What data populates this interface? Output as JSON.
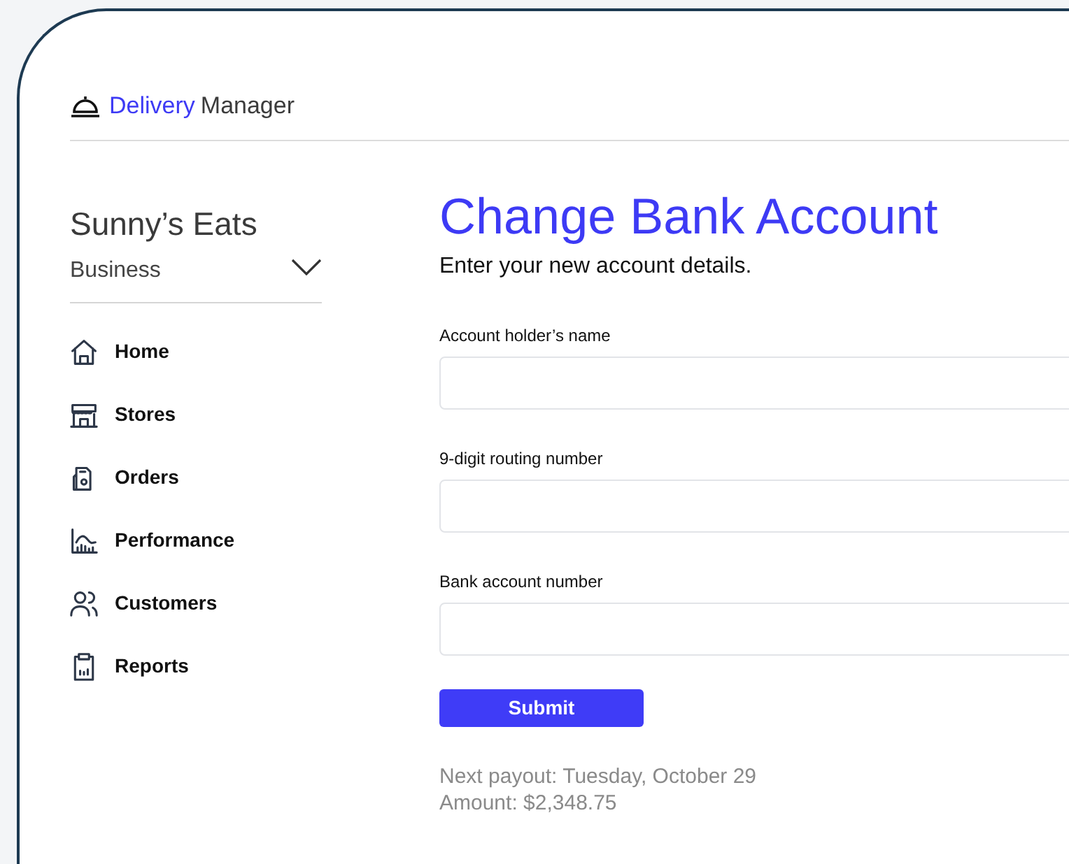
{
  "brand": {
    "part_1": "Delivery",
    "part_2": "Manager"
  },
  "account": {
    "name": "Sunny’s Eats",
    "type": "Business"
  },
  "nav": [
    {
      "label": "Home",
      "kind": "home"
    },
    {
      "label": "Stores",
      "kind": "store"
    },
    {
      "label": "Orders",
      "kind": "orders"
    },
    {
      "label": "Performance",
      "kind": "chart"
    },
    {
      "label": "Customers",
      "kind": "people"
    },
    {
      "label": "Reports",
      "kind": "clipboard"
    }
  ],
  "page": {
    "title": "Change Bank Account",
    "subtitle": "Enter your new account details."
  },
  "fields": [
    {
      "label": "Account holder’s name"
    },
    {
      "label": "9-digit routing number"
    },
    {
      "label": "Bank account number"
    }
  ],
  "submit": "Submit",
  "payout": {
    "next": "Next payout: Tuesday, October 29",
    "amount": "Amount: $2,348.75"
  }
}
